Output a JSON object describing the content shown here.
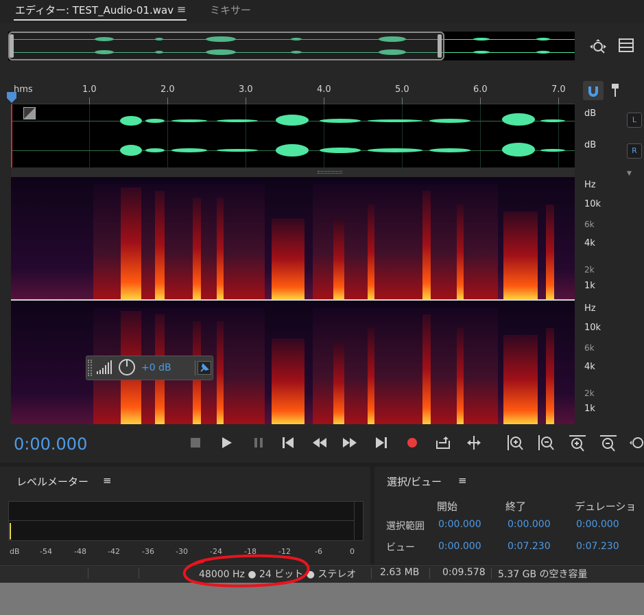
{
  "tabs": {
    "editor": "エディター: TEST_Audio-01.wav",
    "menu_glyph": "≡",
    "mixer": "ミキサー"
  },
  "ruler": {
    "unit": "hms",
    "ticks": [
      "1.0",
      "2.0",
      "3.0",
      "4.0",
      "5.0",
      "6.0",
      "7.0"
    ]
  },
  "channels": {
    "db_label": "dB",
    "left": "L",
    "right": "R"
  },
  "spectrum": {
    "unit": "Hz",
    "labels": [
      "10k",
      "6k",
      "4k",
      "2k",
      "1k"
    ]
  },
  "hud": {
    "gain": "+0 dB"
  },
  "transport": {
    "time": "0:00.000"
  },
  "level_meter": {
    "title": "レベルメーター",
    "menu_glyph": "≡",
    "scale": [
      "dB",
      "-54",
      "-48",
      "-42",
      "-36",
      "-30",
      "-24",
      "-18",
      "-12",
      "-6",
      "0"
    ]
  },
  "selection_view": {
    "title": "選択/ビュー",
    "menu_glyph": "≡",
    "headers": [
      "開始",
      "終了",
      "デュレーショ"
    ],
    "rows": [
      {
        "label": "選択範囲",
        "start": "0:00.000",
        "end": "0:00.000",
        "duration": "0:00.000"
      },
      {
        "label": "ビュー",
        "start": "0:00.000",
        "end": "0:07.230",
        "duration": "0:07.230"
      }
    ]
  },
  "status_bar": {
    "format": "48000 Hz ● 24 ビット ● ステレオ",
    "size": "2.63 MB",
    "duration": "0:09.578",
    "free_space": "5.37 GB の空き容量"
  },
  "colors": {
    "accent": "#4e9be6",
    "waveform": "#4ee6a0",
    "record": "#e83c3c",
    "annotation": "#e8141e"
  }
}
